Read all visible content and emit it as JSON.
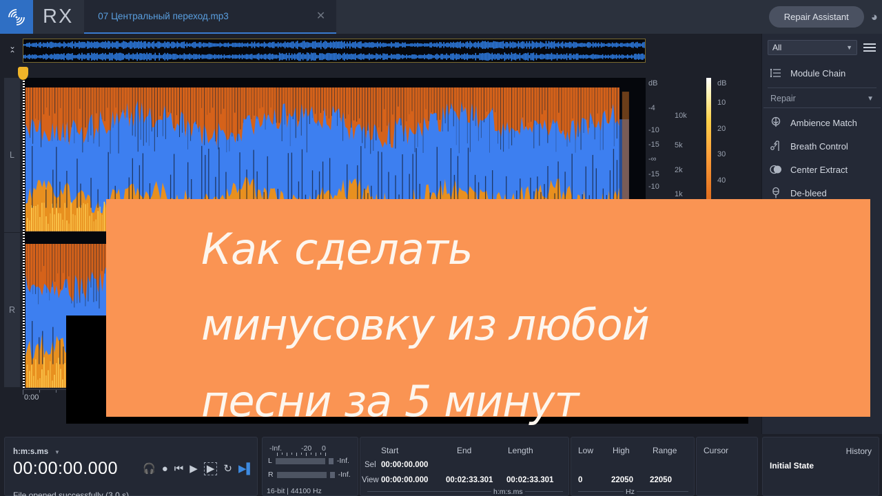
{
  "app": {
    "name": "RX",
    "logo_icon": "rx-waves-logo"
  },
  "titlebar": {
    "tab_title": "07 Центральный переход.mp3",
    "tab_close_icon": "close-icon",
    "repair_assistant_label": "Repair Assistant",
    "assistant_icon": "assistant-icon"
  },
  "overview": {
    "collapse_icon": "collapse-chevrons-icon"
  },
  "editor": {
    "channel_labels": [
      "L",
      "R"
    ],
    "playhead_icon": "playhead-marker",
    "db_axis": {
      "title": "dB",
      "ticks": [
        "-4",
        "-10",
        "-15",
        "-∞",
        "-15",
        "-10"
      ]
    },
    "freq_axis": {
      "ticks": [
        "10k",
        "5k",
        "2k",
        "1k"
      ]
    },
    "colorbar": {
      "title": "dB",
      "ticks": [
        "10",
        "20",
        "30",
        "40"
      ]
    },
    "timeline": {
      "labels": [
        "0:00"
      ]
    },
    "wave_tool_icon": "waveform-icon",
    "expand_icon": "chevron-right-icon"
  },
  "sidebar": {
    "filter_value": "All",
    "filter_chevron_icon": "chevron-down-icon",
    "menu_icon": "hamburger-menu-icon",
    "module_chain": {
      "label": "Module Chain",
      "icon": "module-chain-icon"
    },
    "group": {
      "label": "Repair",
      "chevron_icon": "chevron-down-icon"
    },
    "modules": [
      {
        "label": "Ambience Match",
        "icon": "ambience-match-icon"
      },
      {
        "label": "Breath Control",
        "icon": "breath-control-icon"
      },
      {
        "label": "Center Extract",
        "icon": "center-extract-icon"
      },
      {
        "label": "De-bleed",
        "icon": "de-bleed-icon"
      }
    ]
  },
  "statusbar": {
    "format_label": "h:m:s.ms",
    "format_caret_icon": "caret-down-icon",
    "playhead_time": "00:00:00.000",
    "transport": [
      {
        "name": "monitor-headphones-button",
        "icon": "headphones-icon"
      },
      {
        "name": "record-button",
        "icon": "record-circle-icon"
      },
      {
        "name": "go-to-start-button",
        "icon": "skip-back-icon"
      },
      {
        "name": "play-button",
        "icon": "play-icon"
      },
      {
        "name": "play-selection-button",
        "icon": "play-selection-icon"
      },
      {
        "name": "loop-button",
        "icon": "loop-icon"
      },
      {
        "name": "play-to-end-button",
        "icon": "play-to-end-icon"
      }
    ],
    "status_message": "File opened successfully (3.0 s)",
    "meters": {
      "scale": [
        "-Inf.",
        "-20",
        "0"
      ],
      "rows": [
        {
          "channel": "L",
          "value": "-Inf."
        },
        {
          "channel": "R",
          "value": "-Inf."
        }
      ],
      "bitrate": "16-bit | 44100 Hz"
    },
    "times": {
      "headers": [
        "Start",
        "End",
        "Length"
      ],
      "rows": [
        {
          "label": "Sel",
          "start": "00:00:00.000",
          "end": "",
          "length": ""
        },
        {
          "label": "View",
          "start": "00:00:00.000",
          "end": "00:02:33.301",
          "length": "00:02:33.301"
        }
      ],
      "unit": "h:m:s.ms"
    },
    "frequency": {
      "headers": [
        "Low",
        "High",
        "Range"
      ],
      "values": [
        "0",
        "22050",
        "22050"
      ],
      "unit": "Hz"
    },
    "cursor": {
      "header": "Cursor"
    },
    "history": {
      "title": "History",
      "items": [
        "Initial State"
      ]
    }
  },
  "overlay": {
    "background_color": "#fa9453",
    "text_color": "#fdf6ee",
    "lines": [
      "Как сделать",
      "минусовку из любой",
      "песни за 5 минут"
    ]
  }
}
